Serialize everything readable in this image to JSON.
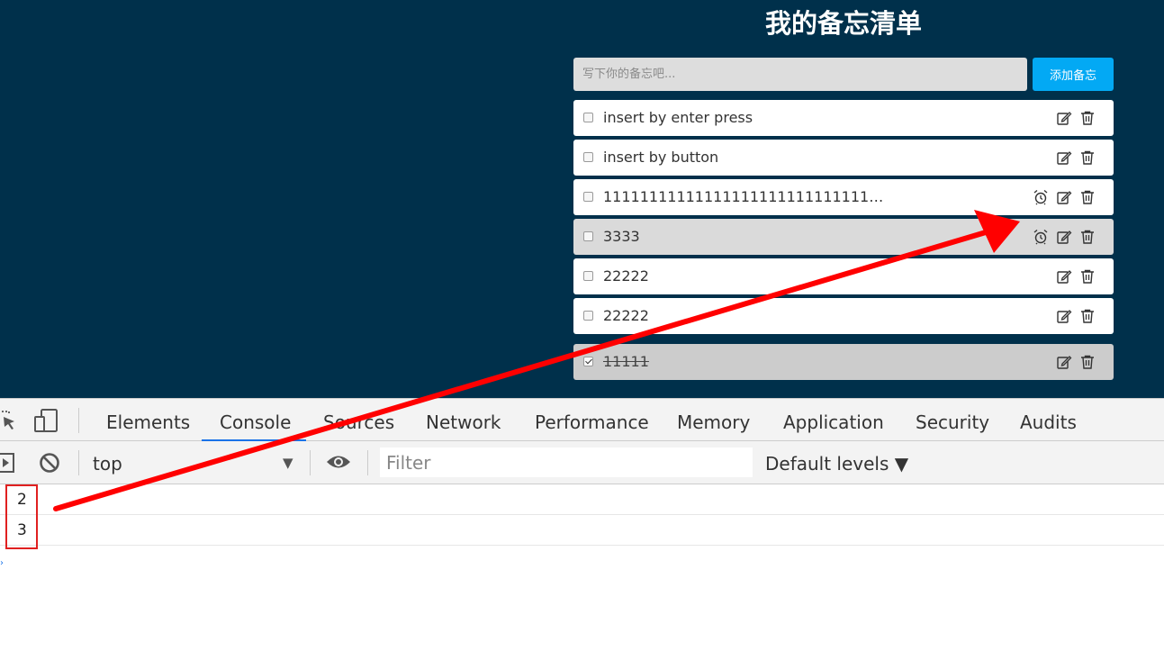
{
  "app": {
    "title": "我的备忘清单",
    "input_placeholder": "写下你的备忘吧...",
    "add_button_label": "添加备忘",
    "memos": [
      {
        "text": "insert by enter press",
        "checked": false,
        "has_alarm": false
      },
      {
        "text": "insert by button",
        "checked": false,
        "has_alarm": false
      },
      {
        "text": "11111111111111111111111111111…",
        "checked": false,
        "has_alarm": true
      },
      {
        "text": "3333",
        "checked": false,
        "has_alarm": true
      },
      {
        "text": "22222",
        "checked": false,
        "has_alarm": false
      },
      {
        "text": "22222",
        "checked": false,
        "has_alarm": false
      },
      {
        "text": "11111",
        "checked": true,
        "has_alarm": false
      }
    ]
  },
  "devtools": {
    "tabs": [
      "Elements",
      "Console",
      "Sources",
      "Network",
      "Performance",
      "Memory",
      "Application",
      "Security",
      "Audits"
    ],
    "active_tab": "Console",
    "context": "top",
    "filter_placeholder": "Filter",
    "levels_label": "Default levels ▼",
    "console_output": [
      "2",
      "3"
    ]
  },
  "colors": {
    "app_background": "#00304b",
    "add_button": "#03a9f4",
    "annotation": "#ff0000"
  }
}
